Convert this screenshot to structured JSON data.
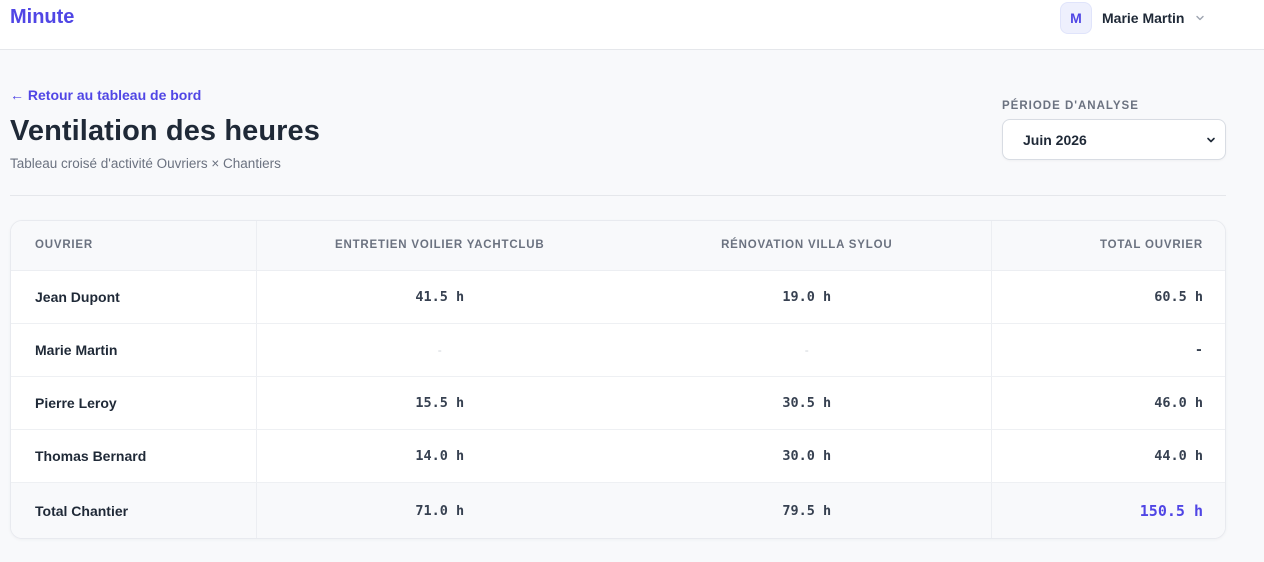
{
  "app": {
    "brand": "Minute"
  },
  "user": {
    "initial": "M",
    "name": "Marie Martin"
  },
  "nav": {
    "back_label": "← Retour au tableau de bord"
  },
  "page": {
    "title": "Ventilation des heures",
    "subtitle": "Tableau croisé d'activité Ouvriers × Chantiers"
  },
  "period": {
    "label": "Période d'analyse",
    "selected": "Juin 2026"
  },
  "table": {
    "headers": [
      "Ouvrier",
      "Entretien Voilier YachtClub",
      "Rénovation Villa Sylou",
      "Total Ouvrier"
    ],
    "rows": [
      {
        "name": "Jean Dupont",
        "c1": "41.5 h",
        "c2": "19.0 h",
        "total": "60.5 h"
      },
      {
        "name": "Marie Martin",
        "c1": "-",
        "c2": "-",
        "total": "-"
      },
      {
        "name": "Pierre Leroy",
        "c1": "15.5 h",
        "c2": "30.5 h",
        "total": "46.0 h"
      },
      {
        "name": "Thomas Bernard",
        "c1": "14.0 h",
        "c2": "30.0 h",
        "total": "44.0 h"
      }
    ],
    "footer": {
      "name": "Total Chantier",
      "c1": "71.0 h",
      "c2": "79.5 h",
      "total": "150.5 h"
    }
  },
  "colors": {
    "accent": "#5046e5",
    "text": "#1f2937",
    "muted": "#6b7280"
  },
  "icons": {
    "user_menu": "chevron-down-icon",
    "select": "chevron-down-icon"
  }
}
